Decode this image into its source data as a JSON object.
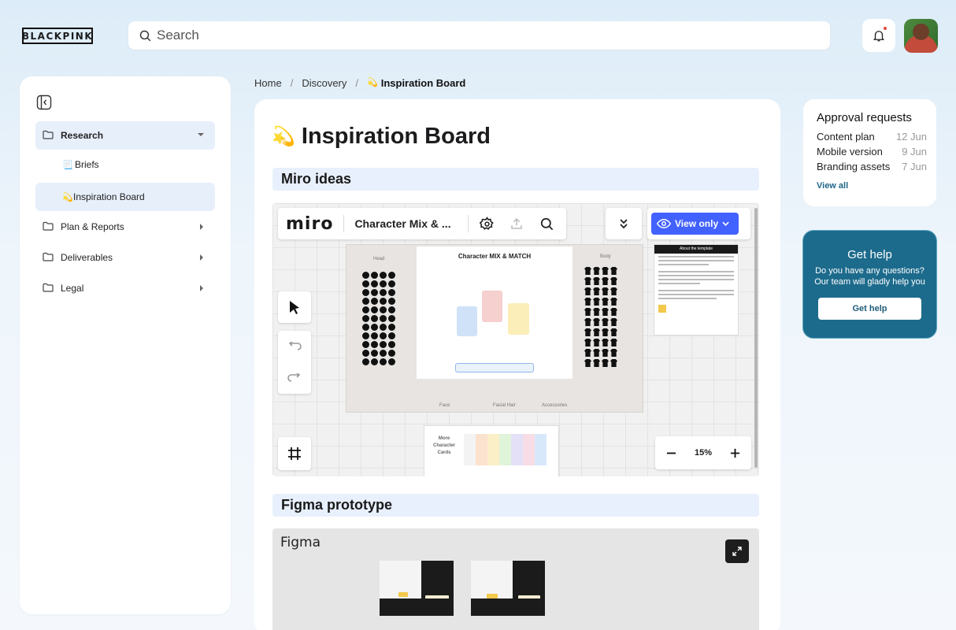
{
  "brand": {
    "logo_text": "BLACKPINK"
  },
  "search": {
    "placeholder": "Search"
  },
  "sidebar": {
    "items": [
      {
        "label": "Research",
        "icon": "folder-icon"
      },
      {
        "label": "Briefs",
        "emoji": "📃"
      },
      {
        "label": "Inspiration Board",
        "emoji": "💫"
      },
      {
        "label": "Plan & Reports",
        "icon": "folder-icon"
      },
      {
        "label": "Deliverables",
        "icon": "folder-icon"
      },
      {
        "label": "Legal",
        "icon": "folder-icon"
      }
    ]
  },
  "breadcrumb": {
    "items": [
      "Home",
      "Discovery"
    ],
    "current_emoji": "💫",
    "current": "Inspiration Board",
    "separator": "/"
  },
  "page": {
    "title_emoji": "💫",
    "title": "Inspiration Board",
    "sections": [
      {
        "title": "Miro ideas"
      },
      {
        "title": "Figma prototype"
      }
    ]
  },
  "miro": {
    "brand": "miro",
    "board_name": "Character Mix & ...",
    "view_only_label": "View only",
    "zoom_level": "15%",
    "board": {
      "title": "Character MIX & MATCH",
      "head_label": "Head",
      "body_label": "Body",
      "face_label": "Face",
      "facial_hair_label": "Facial Hair",
      "accessories_label": "Accessories",
      "about_title": "About the template",
      "more_cards_label": "More Character Cards"
    }
  },
  "figma": {
    "brand": "Figma"
  },
  "approvals": {
    "title": "Approval requests",
    "items": [
      {
        "name": "Content plan",
        "date": "12 Jun"
      },
      {
        "name": "Mobile version",
        "date": "9 Jun"
      },
      {
        "name": "Branding assets",
        "date": "7 Jun"
      }
    ],
    "view_all": "View all"
  },
  "help": {
    "title": "Get help",
    "text": "Do you have any questions? Our team will gladly help you",
    "button": "Get help"
  },
  "colors": {
    "accent_blue": "#4262ff",
    "help_bg": "#1d6b8c",
    "active_nav": "#e7effb",
    "notification_dot": "#e4463f"
  }
}
